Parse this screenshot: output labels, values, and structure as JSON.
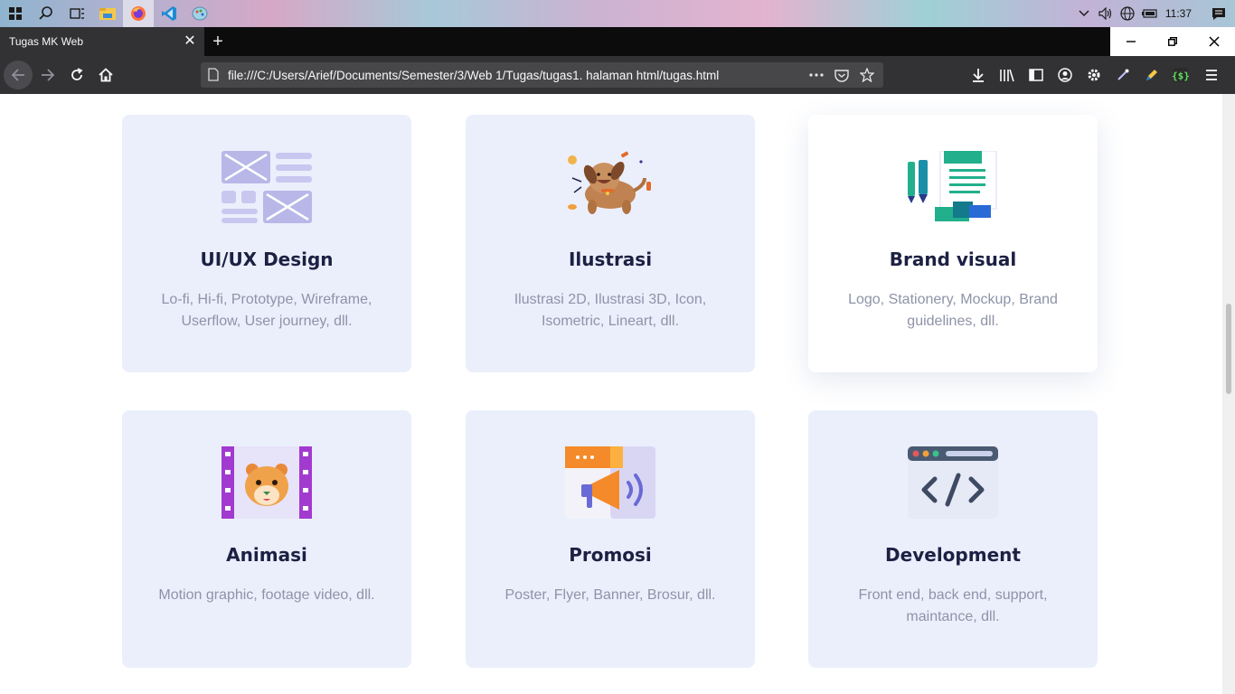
{
  "taskbar": {
    "icons": [
      "start-icon",
      "search-icon",
      "task-view-icon",
      "file-explorer-icon",
      "firefox-icon",
      "vscode-icon",
      "paint-icon"
    ],
    "clock": "11:37"
  },
  "browser": {
    "tab_title": "Tugas MK Web",
    "url": "file:///C:/Users/Arief/Documents/Semester/3/Web 1/Tugas/tugas1. halaman html/tugas.html"
  },
  "cards": [
    {
      "title": "UI/UX Design",
      "desc": "Lo-fi, Hi-fi, Prototype, Wireframe, Userflow, User journey, dll.",
      "icon": "wireframe-icon"
    },
    {
      "title": "Ilustrasi",
      "desc": "Ilustrasi 2D, Ilustrasi 3D, Icon, Isometric, Lineart, dll.",
      "icon": "dog-illustration-icon"
    },
    {
      "title": "Brand visual",
      "desc": "Logo, Stationery, Mockup, Brand guidelines, dll.",
      "icon": "stationery-icon"
    },
    {
      "title": "Animasi",
      "desc": "Motion graphic, footage video, dll.",
      "icon": "film-hamster-icon"
    },
    {
      "title": "Promosi",
      "desc": "Poster, Flyer, Banner, Brosur, dll.",
      "icon": "megaphone-icon"
    },
    {
      "title": "Development",
      "desc": "Front end, back end, support, maintance, dll.",
      "icon": "code-window-icon"
    }
  ]
}
